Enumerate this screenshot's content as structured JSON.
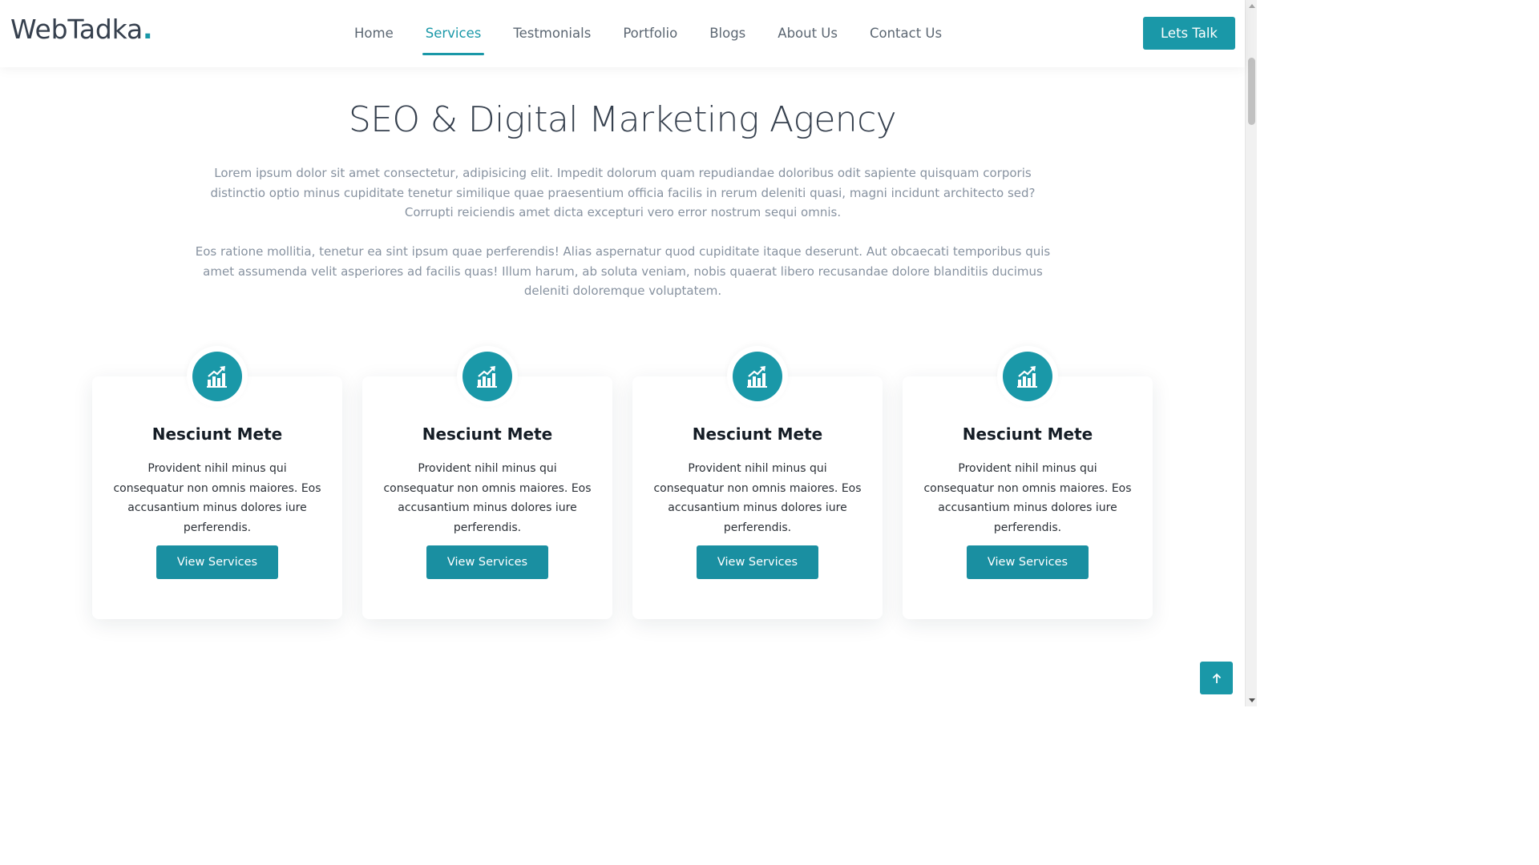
{
  "brand": {
    "name": "WebTadka",
    "dot": "."
  },
  "nav": {
    "items": [
      {
        "label": "Home",
        "active": false
      },
      {
        "label": "Services",
        "active": true
      },
      {
        "label": "Testmonials",
        "active": false
      },
      {
        "label": "Portfolio",
        "active": false
      },
      {
        "label": "Blogs",
        "active": false
      },
      {
        "label": "About Us",
        "active": false
      },
      {
        "label": "Contact Us",
        "active": false
      }
    ],
    "cta_label": "Lets Talk"
  },
  "hero": {
    "title": "SEO & Digital Marketing Agency",
    "paragraph1": "Lorem ipsum dolor sit amet consectetur, adipisicing elit. Impedit dolorum quam repudiandae doloribus odit sapiente quisquam corporis distinctio optio minus cupiditate tenetur similique quae praesentium officia facilis in rerum deleniti quasi, magni incidunt architecto sed? Corrupti reiciendis amet dicta excepturi vero error nostrum sequi omnis.",
    "paragraph2": "Eos ratione mollitia, tenetur ea sint ipsum quae perferendis! Alias aspernatur quod cupiditate itaque deserunt. Aut obcaecati temporibus quis amet assumenda velit asperiores ad facilis quas! Illum harum, ab soluta veniam, nobis quaerat libero recusandae dolore blanditiis ducimus deleniti doloremque voluptatem."
  },
  "cards": [
    {
      "icon": "chart-growth-icon",
      "title": "Nesciunt Mete",
      "text": "Provident nihil minus qui consequatur non omnis maiores. Eos accusantium minus dolores iure perferendis.",
      "button": "View Services"
    },
    {
      "icon": "chart-growth-icon",
      "title": "Nesciunt Mete",
      "text": "Provident nihil minus qui consequatur non omnis maiores. Eos accusantium minus dolores iure perferendis.",
      "button": "View Services"
    },
    {
      "icon": "chart-growth-icon",
      "title": "Nesciunt Mete",
      "text": "Provident nihil minus qui consequatur non omnis maiores. Eos accusantium minus dolores iure perferendis.",
      "button": "View Services"
    },
    {
      "icon": "chart-growth-icon",
      "title": "Nesciunt Mete",
      "text": "Provident nihil minus qui consequatur non omnis maiores. Eos accusantium minus dolores iure perferendis.",
      "button": "View Services"
    }
  ],
  "scroll_top_icon": "arrow-up-icon",
  "colors": {
    "accent": "#1a98a8",
    "button": "#1a8fa1",
    "heading": "#36404e",
    "muted": "#8792a0"
  }
}
